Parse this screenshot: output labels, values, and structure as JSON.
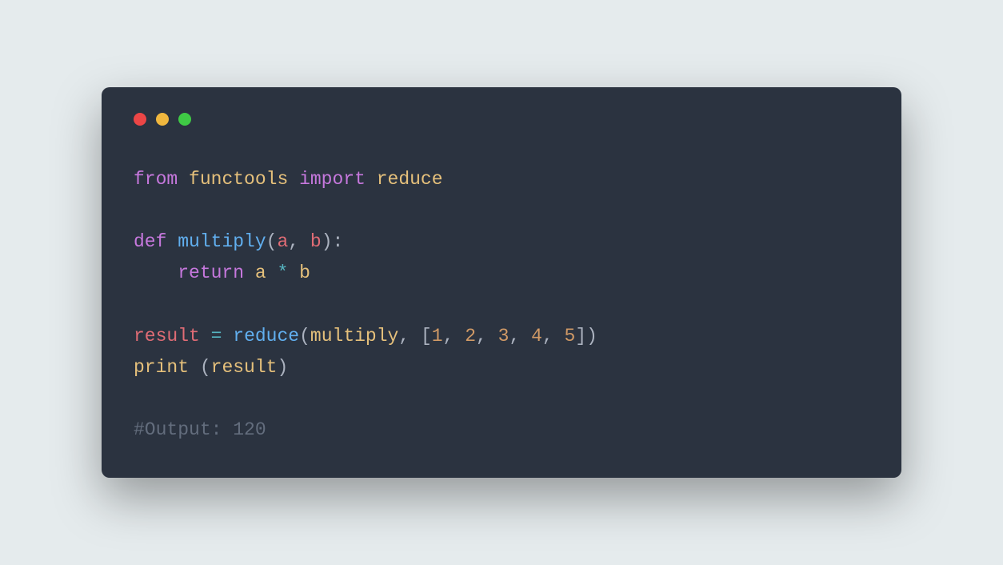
{
  "traffic_lights": {
    "red": "#ec4646",
    "yellow": "#f0b73e",
    "green": "#3fca45"
  },
  "code": {
    "line1": {
      "kw_from": "from",
      "module": "functools",
      "kw_import": "import",
      "name": "reduce"
    },
    "line3": {
      "kw_def": "def",
      "funcname": "multiply",
      "lparen": "(",
      "param_a": "a",
      "comma": ",",
      "param_b": "b",
      "rparen_colon": "):"
    },
    "line4": {
      "kw_return": "return",
      "var_a": "a",
      "op_mul": "*",
      "var_b": "b"
    },
    "line6": {
      "var_result": "result",
      "op_eq": "=",
      "func_reduce": "reduce",
      "lparen": "(",
      "arg_multiply": "multiply",
      "comma": ",",
      "lbracket": "[",
      "n1": "1",
      "c1": ",",
      "n2": "2",
      "c2": ",",
      "n3": "3",
      "c3": ",",
      "n4": "4",
      "c4": ",",
      "n5": "5",
      "rbracket_rparen": "])"
    },
    "line7": {
      "func_print": "print",
      "lparen": "(",
      "arg": "result",
      "rparen": ")"
    },
    "line9": {
      "comment": "#Output: 120"
    }
  }
}
